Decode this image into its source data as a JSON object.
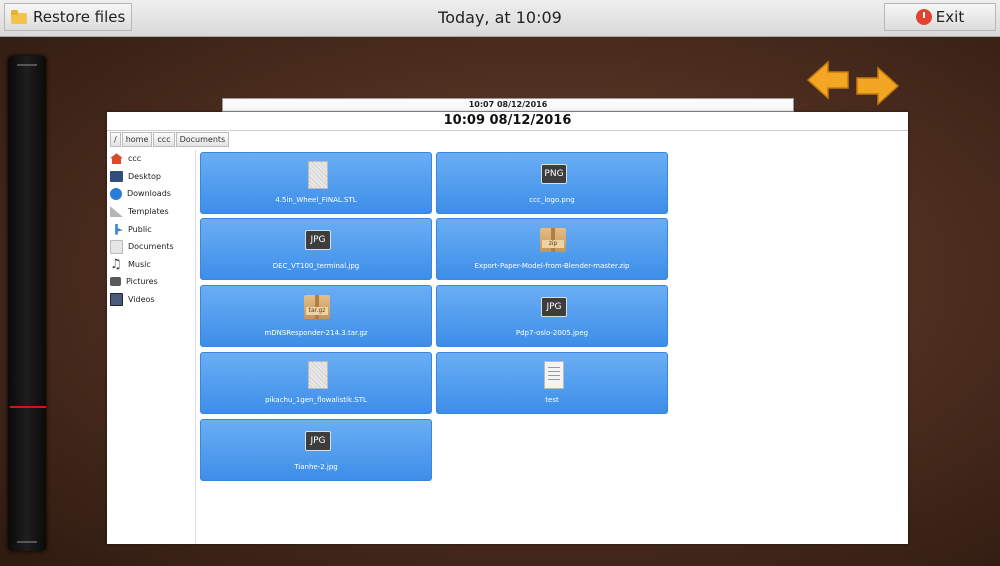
{
  "topbar": {
    "restore_label": "Restore files",
    "title": "Today, at 10:09",
    "exit_label": "Exit"
  },
  "snapshots": {
    "previous": "10:07 08/12/2016",
    "current": "10:09 08/12/2016"
  },
  "pathbar": [
    "/",
    "home",
    "ccc",
    "Documents"
  ],
  "sidebar": [
    {
      "label": "ccc",
      "icon": "home-icon",
      "color": "#d84b2b"
    },
    {
      "label": "Desktop",
      "icon": "desktop-icon",
      "color": "#2f4f7a"
    },
    {
      "label": "Downloads",
      "icon": "downloads-icon",
      "color": "#2a7bd6"
    },
    {
      "label": "Templates",
      "icon": "templates-icon",
      "color": "#9a9a9a"
    },
    {
      "label": "Public",
      "icon": "public-icon",
      "color": "#3b84d9"
    },
    {
      "label": "Documents",
      "icon": "documents-icon",
      "color": "#cfcfcf"
    },
    {
      "label": "Music",
      "icon": "music-icon",
      "color": "#555555"
    },
    {
      "label": "Pictures",
      "icon": "pictures-icon",
      "color": "#666666"
    },
    {
      "label": "Videos",
      "icon": "videos-icon",
      "color": "#4a5a7a"
    }
  ],
  "files": [
    {
      "name": "4.5in_Wheel_FINAL.STL",
      "icon": "stl-file-icon"
    },
    {
      "name": "ccc_logo.png",
      "icon": "png-file-icon",
      "badge": "PNG"
    },
    {
      "name": "DEC_VT100_terminal.jpg",
      "icon": "jpg-file-icon",
      "badge": "JPG"
    },
    {
      "name": "Export-Paper-Model-from-Blender-master.zip",
      "icon": "zip-archive-icon",
      "badge": "zip"
    },
    {
      "name": "mDNSResponder-214.3.tar.gz",
      "icon": "tar-archive-icon",
      "badge": "tar.gz"
    },
    {
      "name": "Pdp7-oslo-2005.jpeg",
      "icon": "jpeg-file-icon",
      "badge": "JPG"
    },
    {
      "name": "pikachu_1gen_flowalistik.STL",
      "icon": "stl-file-icon"
    },
    {
      "name": "test",
      "icon": "text-file-icon"
    },
    {
      "name": "Tianhe-2.jpg",
      "icon": "jpg-file-icon",
      "badge": "JPG"
    }
  ],
  "colors": {
    "accent_tile": "#4a98ef",
    "timeline_marker": "#d8140f",
    "arrows": "#f2a623"
  }
}
